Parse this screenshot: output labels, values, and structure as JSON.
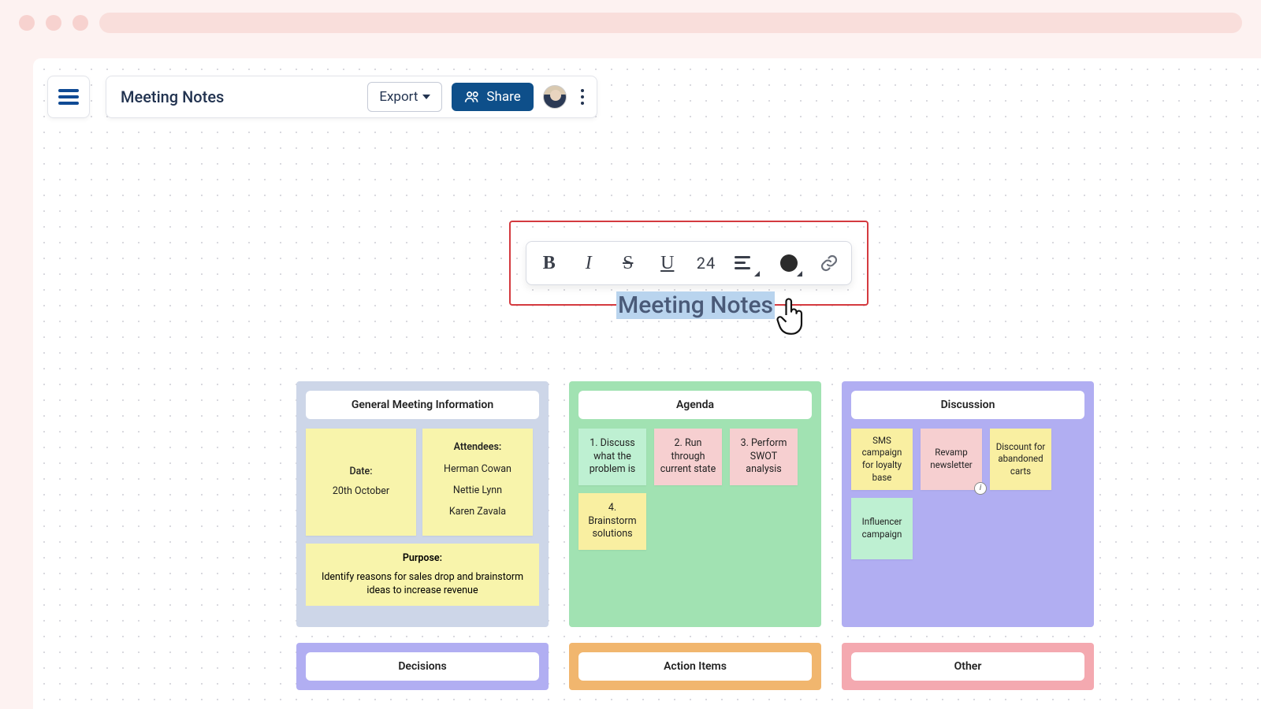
{
  "header": {
    "doc_title": "Meeting Notes",
    "export_label": "Export",
    "share_label": "Share"
  },
  "toolbar": {
    "font_size": "24"
  },
  "canvas": {
    "selected_text": "Meeting Notes"
  },
  "panels": {
    "general": {
      "title": "General Meeting Information",
      "date_label": "Date:",
      "date_value": "20th October",
      "attendees_label": "Attendees:",
      "attendees": [
        "Herman Cowan",
        "Nettie Lynn",
        "Karen Zavala"
      ],
      "purpose_label": "Purpose:",
      "purpose_text": "Identify reasons for sales drop and brainstorm ideas to increase revenue"
    },
    "agenda": {
      "title": "Agenda",
      "items": [
        "1. Discuss what the problem is",
        "2. Run through current state",
        "3. Perform SWOT analysis",
        "4. Brainstorm solutions"
      ]
    },
    "discussion": {
      "title": "Discussion",
      "items": [
        "SMS campaign for loyalty base",
        "Revamp newsletter",
        "Discount for abandoned carts",
        "Influencer campaign"
      ]
    },
    "decisions": {
      "title": "Decisions"
    },
    "actions": {
      "title": "Action Items"
    },
    "other": {
      "title": "Other"
    }
  }
}
